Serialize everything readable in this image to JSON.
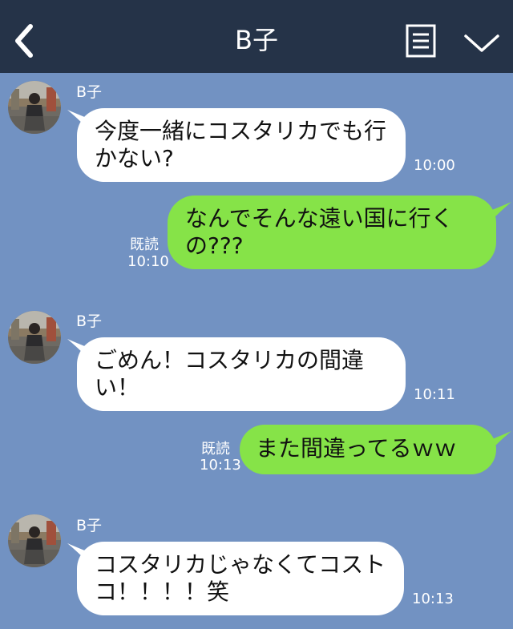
{
  "header": {
    "title": "B子"
  },
  "messages": [
    {
      "sender": "B子",
      "direction": "incoming",
      "text": "今度一緒にコスタリカでも行かない?",
      "time": "10:00"
    },
    {
      "direction": "outgoing",
      "text": "なんでそんな遠い国に行くの???",
      "status": "既読",
      "time": "10:10"
    },
    {
      "sender": "B子",
      "direction": "incoming",
      "text": "ごめん！コスタリカの間違い！",
      "time": "10:11"
    },
    {
      "direction": "outgoing",
      "text": "また間違ってるｗｗ",
      "status": "既読",
      "time": "10:13"
    },
    {
      "sender": "B子",
      "direction": "incoming",
      "text": "コスタリカじゃなくてコストコ！！！！笑",
      "time": "10:13"
    }
  ],
  "colors": {
    "header_bg": "#253348",
    "chat_bg": "#7292c2",
    "incoming_bubble": "#ffffff",
    "outgoing_bubble": "#86e348"
  },
  "icons": {
    "back": "back-arrow-icon",
    "menu": "menu-icon",
    "collapse": "chevron-down-icon"
  }
}
